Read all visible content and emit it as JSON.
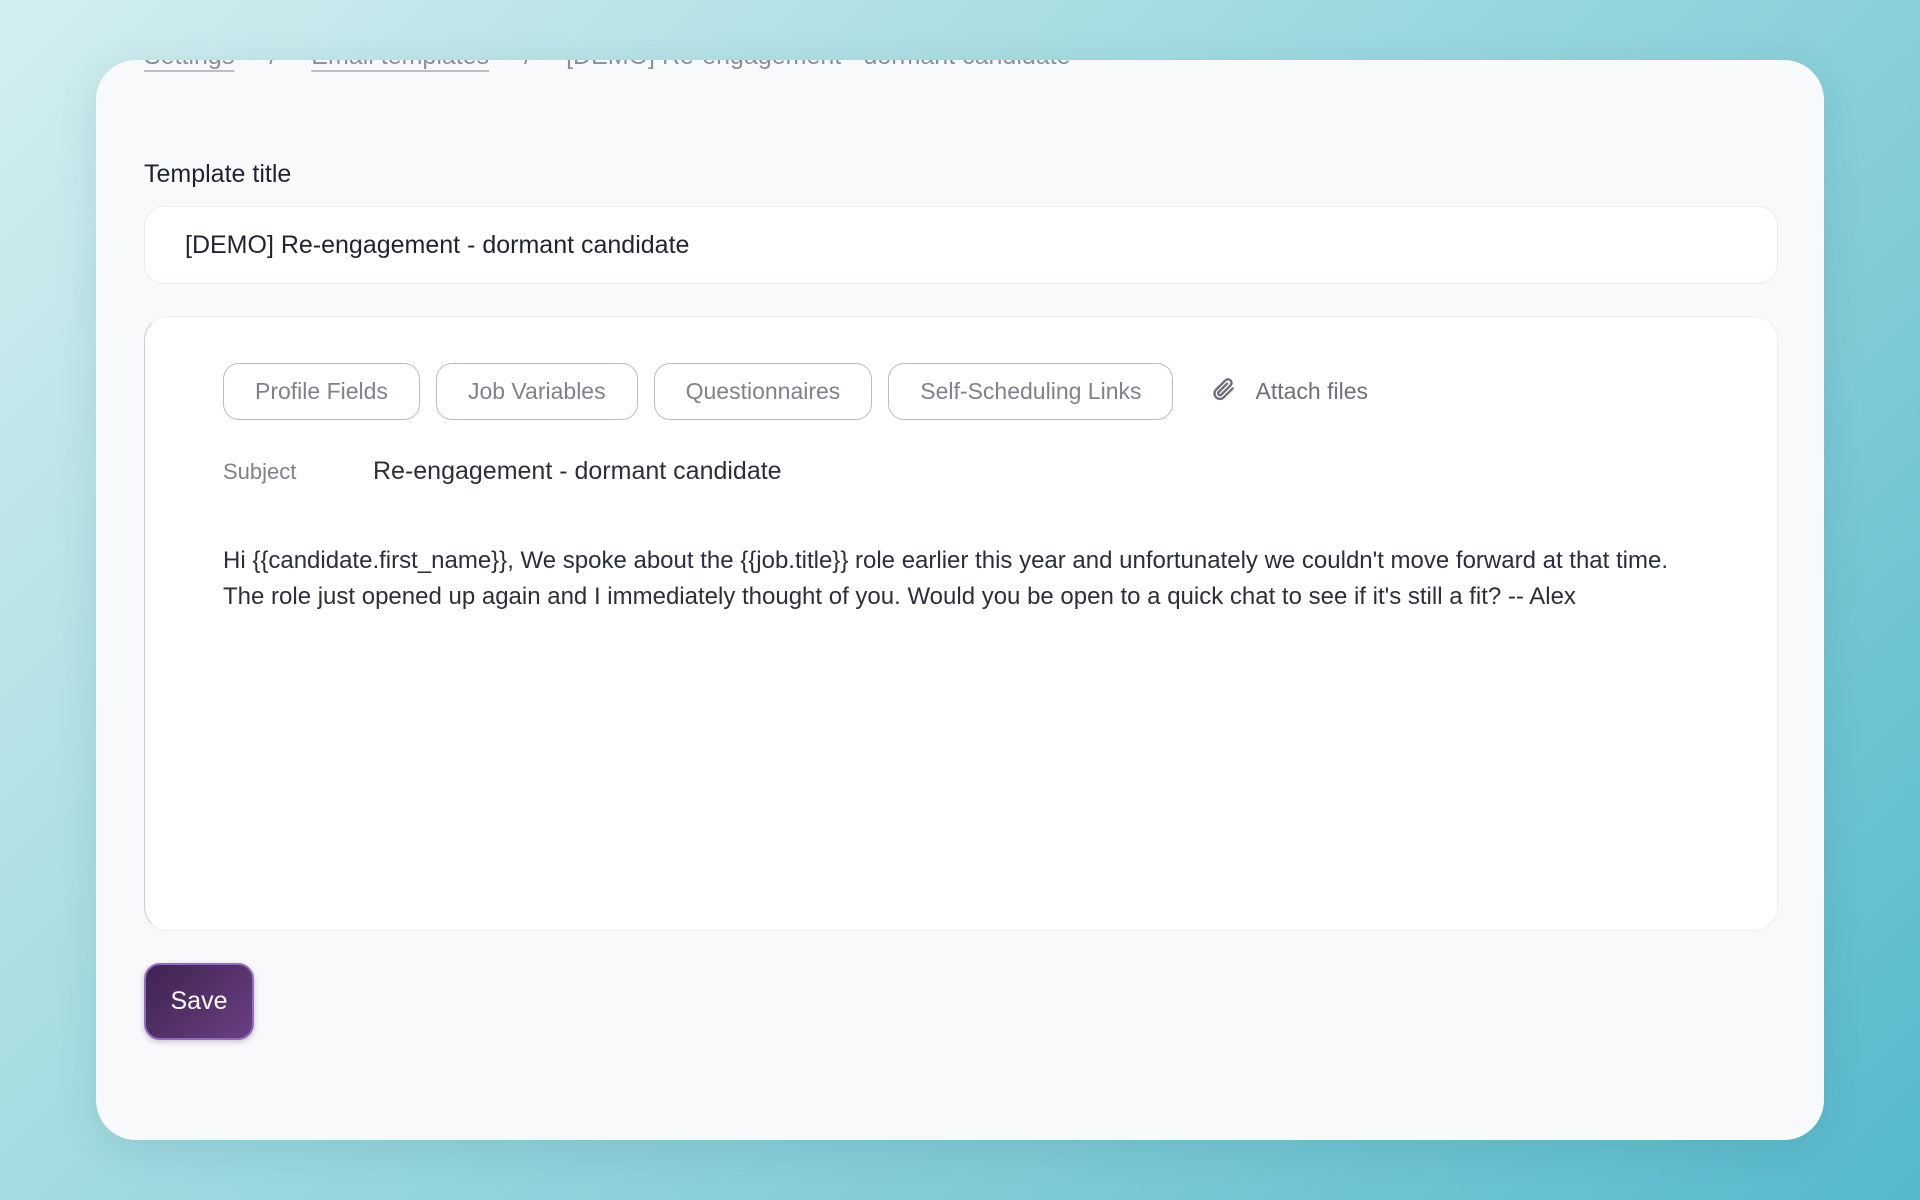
{
  "breadcrumb": {
    "items": [
      "Settings",
      "Email templates"
    ],
    "separator": "/",
    "current": "[DEMO] Re-engagement - dormant candidate"
  },
  "template": {
    "title_label": "Template title",
    "title_value": "[DEMO] Re-engagement - dormant candidate"
  },
  "editor": {
    "toolbar": {
      "profile_fields": "Profile Fields",
      "job_variables": "Job Variables",
      "questionnaires": "Questionnaires",
      "self_scheduling_links": "Self-Scheduling Links",
      "attach_files": "Attach files",
      "attach_icon": "paperclip-icon"
    },
    "subject_label": "Subject",
    "subject_value": "Re-engagement - dormant candidate",
    "body": "Hi {{candidate.first_name}}, We spoke about the {{job.title}} role earlier this year and unfortunately we couldn't move forward at that time. The role just opened up again and I immediately thought of you. Would you be open to a quick chat to see if it's still a fit? -- Alex"
  },
  "actions": {
    "save_label": "Save"
  },
  "colors": {
    "save_button_start": "#3f2350",
    "save_button_end": "#6a3f82",
    "save_button_border": "#8e6cc0",
    "card_background": "#f8f9fb"
  }
}
